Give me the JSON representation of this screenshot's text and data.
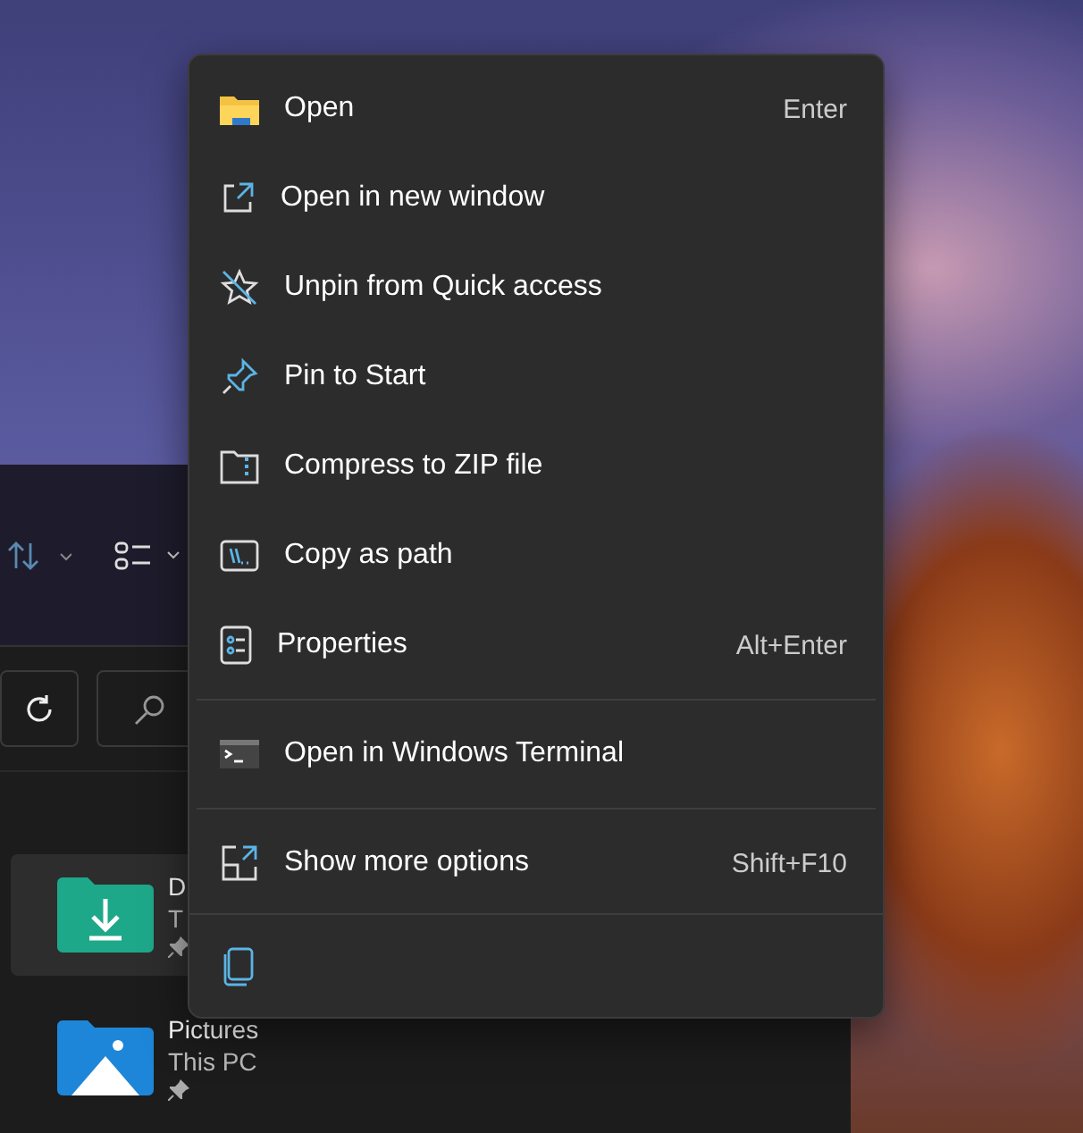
{
  "explorer": {
    "files": [
      {
        "name": "D",
        "location": "T",
        "selected": true,
        "pinned": true
      },
      {
        "name": "Pictures",
        "location": "This PC",
        "selected": false,
        "pinned": true
      }
    ]
  },
  "menu": {
    "groups": [
      [
        {
          "label": "Open",
          "shortcut": "Enter"
        },
        {
          "label": "Open in new window"
        },
        {
          "label": "Unpin from Quick access"
        },
        {
          "label": "Pin to Start"
        },
        {
          "label": "Compress to ZIP file"
        },
        {
          "label": "Copy as path"
        },
        {
          "label": "Properties",
          "shortcut": "Alt+Enter"
        }
      ],
      [
        {
          "label": "Open in Windows Terminal"
        }
      ],
      [
        {
          "label": "Show more options",
          "shortcut": "Shift+F10"
        }
      ]
    ]
  }
}
